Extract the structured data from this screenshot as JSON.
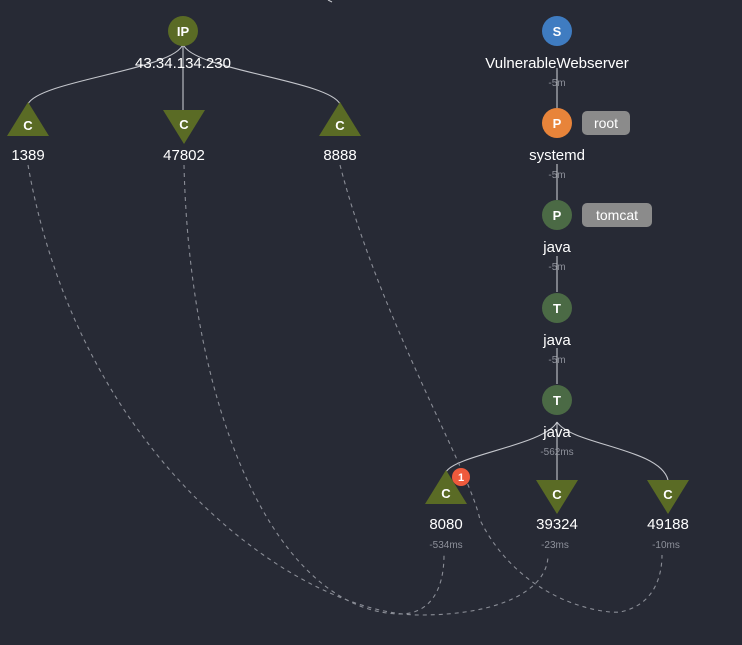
{
  "colors": {
    "background": "#272a35",
    "olive": "#5a6b25",
    "green": "#4b6a45",
    "blue": "#3f7cc1",
    "orange": "#e8843a",
    "tag": "#8b8b8b",
    "badge": "#ee5a3c"
  },
  "nodes": {
    "ip": {
      "glyph": "IP",
      "label": "43.34.134.230"
    },
    "c1389": {
      "glyph": "C",
      "label": "1389"
    },
    "c47802": {
      "glyph": "C",
      "label": "47802"
    },
    "c8888": {
      "glyph": "C",
      "label": "8888"
    },
    "server": {
      "glyph": "S",
      "label": "VulnerableWebserver",
      "time": "-5m"
    },
    "systemd": {
      "glyph": "P",
      "label": "systemd",
      "time": "-5m",
      "tag": "root"
    },
    "java_proc": {
      "glyph": "P",
      "label": "java",
      "time": "-5m",
      "tag": "tomcat"
    },
    "java_t1": {
      "glyph": "T",
      "label": "java",
      "time": "-5m"
    },
    "java_t2": {
      "glyph": "T",
      "label": "java",
      "time": "-562ms"
    },
    "c8080": {
      "glyph": "C",
      "label": "8080",
      "time": "-534ms",
      "badge": "1"
    },
    "c39324": {
      "glyph": "C",
      "label": "39324",
      "time": "-23ms"
    },
    "c49188": {
      "glyph": "C",
      "label": "49188",
      "time": "-10ms"
    }
  }
}
